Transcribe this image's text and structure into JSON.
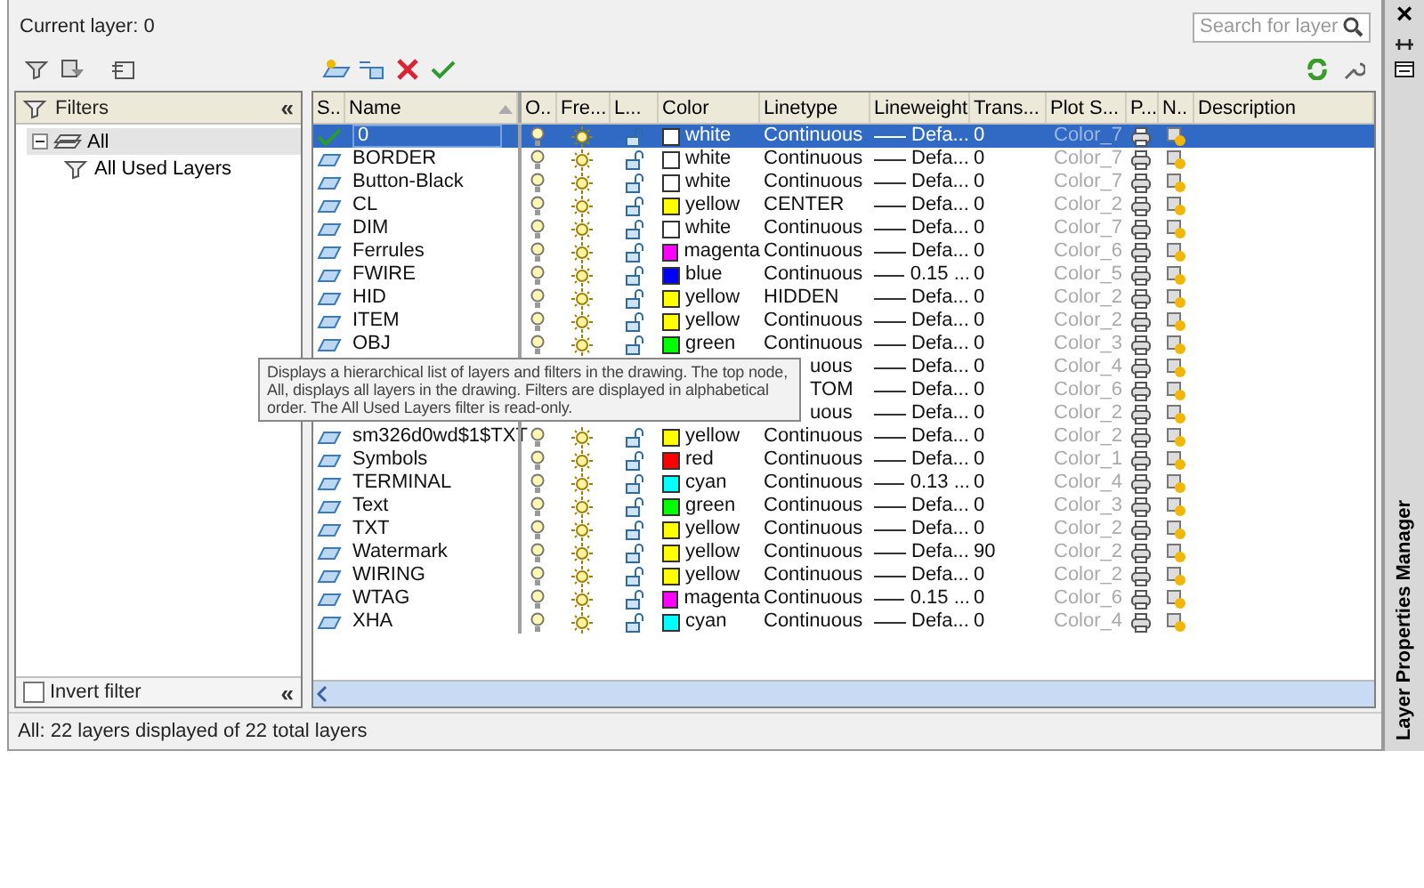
{
  "header": {
    "current_layer": "Current layer: 0",
    "search": {
      "placeholder": "Search for layer"
    }
  },
  "filters": {
    "title": "Filters",
    "collapse": "«",
    "tree": [
      {
        "label": "All",
        "expanded": true,
        "selected": true,
        "children": [
          {
            "label": "All Used Layers",
            "selected": false
          }
        ]
      }
    ],
    "invert_filter": {
      "label": "Invert filter",
      "checked": false
    },
    "collapse_bottom": "«"
  },
  "columns": [
    "S..",
    "Name",
    "O..",
    "Fre...",
    "L...",
    "Color",
    "Linetype",
    "Lineweight",
    "Trans...",
    "Plot S...",
    "P...",
    "N..",
    "Description"
  ],
  "rows": [
    {
      "name": "0",
      "current": true,
      "selected": true,
      "color_name": "white",
      "color": "#ffffff",
      "linetype": "Continuous",
      "lineweight": "Defa...",
      "transparency": "0",
      "plot_style": "Color_7"
    },
    {
      "name": "BORDER",
      "current": false,
      "selected": false,
      "color_name": "white",
      "color": "#ffffff",
      "linetype": "Continuous",
      "lineweight": "Defa...",
      "transparency": "0",
      "plot_style": "Color_7"
    },
    {
      "name": "Button-Black",
      "current": false,
      "selected": false,
      "color_name": "white",
      "color": "#ffffff",
      "linetype": "Continuous",
      "lineweight": "Defa...",
      "transparency": "0",
      "plot_style": "Color_7"
    },
    {
      "name": "CL",
      "current": false,
      "selected": false,
      "color_name": "yellow",
      "color": "#ffff00",
      "linetype": "CENTER",
      "lineweight": "Defa...",
      "transparency": "0",
      "plot_style": "Color_2"
    },
    {
      "name": "DIM",
      "current": false,
      "selected": false,
      "color_name": "white",
      "color": "#ffffff",
      "linetype": "Continuous",
      "lineweight": "Defa...",
      "transparency": "0",
      "plot_style": "Color_7"
    },
    {
      "name": "Ferrules",
      "current": false,
      "selected": false,
      "color_name": "magenta",
      "color": "#ff00ff",
      "linetype": "Continuous",
      "lineweight": "Defa...",
      "transparency": "0",
      "plot_style": "Color_6"
    },
    {
      "name": "FWIRE",
      "current": false,
      "selected": false,
      "color_name": "blue",
      "color": "#0000ff",
      "linetype": "Continuous",
      "lineweight": "0.15 ...",
      "transparency": "0",
      "plot_style": "Color_5"
    },
    {
      "name": "HID",
      "current": false,
      "selected": false,
      "color_name": "yellow",
      "color": "#ffff00",
      "linetype": "HIDDEN",
      "lineweight": "Defa...",
      "transparency": "0",
      "plot_style": "Color_2"
    },
    {
      "name": "ITEM",
      "current": false,
      "selected": false,
      "color_name": "yellow",
      "color": "#ffff00",
      "linetype": "Continuous",
      "lineweight": "Defa...",
      "transparency": "0",
      "plot_style": "Color_2"
    },
    {
      "name": "OBJ",
      "current": false,
      "selected": false,
      "color_name": "green",
      "color": "#00ff00",
      "linetype": "Continuous",
      "lineweight": "Defa...",
      "transparency": "0",
      "plot_style": "Color_3"
    },
    {
      "covered": true,
      "selected": false,
      "linetype": "uous",
      "lineweight": "Defa...",
      "transparency": "0",
      "plot_style": "Color_4"
    },
    {
      "covered": true,
      "selected": false,
      "linetype": "TOM",
      "lineweight": "Defa...",
      "transparency": "0",
      "plot_style": "Color_6"
    },
    {
      "covered": true,
      "selected": false,
      "linetype": "uous",
      "lineweight": "Defa...",
      "transparency": "0",
      "plot_style": "Color_2"
    },
    {
      "name": "sm326d0wd$1$TXT",
      "current": false,
      "selected": false,
      "color_name": "yellow",
      "color": "#ffff00",
      "linetype": "Continuous",
      "lineweight": "Defa...",
      "transparency": "0",
      "plot_style": "Color_2"
    },
    {
      "name": "Symbols",
      "current": false,
      "selected": false,
      "color_name": "red",
      "color": "#ff0000",
      "linetype": "Continuous",
      "lineweight": "Defa...",
      "transparency": "0",
      "plot_style": "Color_1"
    },
    {
      "name": "TERMINAL",
      "current": false,
      "selected": false,
      "color_name": "cyan",
      "color": "#00ffff",
      "linetype": "Continuous",
      "lineweight": "0.13 ...",
      "transparency": "0",
      "plot_style": "Color_4"
    },
    {
      "name": "Text",
      "current": false,
      "selected": false,
      "color_name": "green",
      "color": "#00ff00",
      "linetype": "Continuous",
      "lineweight": "Defa...",
      "transparency": "0",
      "plot_style": "Color_3"
    },
    {
      "name": "TXT",
      "current": false,
      "selected": false,
      "color_name": "yellow",
      "color": "#ffff00",
      "linetype": "Continuous",
      "lineweight": "Defa...",
      "transparency": "0",
      "plot_style": "Color_2"
    },
    {
      "name": "Watermark",
      "current": false,
      "selected": false,
      "color_name": "yellow",
      "color": "#ffff00",
      "linetype": "Continuous",
      "lineweight": "Defa...",
      "transparency": "90",
      "plot_style": "Color_2"
    },
    {
      "name": "WIRING",
      "current": false,
      "selected": false,
      "color_name": "yellow",
      "color": "#ffff00",
      "linetype": "Continuous",
      "lineweight": "Defa...",
      "transparency": "0",
      "plot_style": "Color_2"
    },
    {
      "name": "WTAG",
      "current": false,
      "selected": false,
      "color_name": "magenta",
      "color": "#ff00ff",
      "linetype": "Continuous",
      "lineweight": "0.15 ...",
      "transparency": "0",
      "plot_style": "Color_6"
    },
    {
      "name": "XHA",
      "current": false,
      "selected": false,
      "color_name": "cyan",
      "color": "#00ffff",
      "linetype": "Continuous",
      "lineweight": "Defa...",
      "transparency": "0",
      "plot_style": "Color_4"
    }
  ],
  "tooltip": "Displays a hierarchical list of layers and filters in the drawing. The top node, All, displays all layers in the drawing. Filters are displayed in alphabetical order. The All Used Layers filter is read-only.",
  "status_bar": "All: 22 layers displayed of 22 total layers",
  "side_bar": {
    "close": "×",
    "title": "Layer Properties Manager"
  }
}
